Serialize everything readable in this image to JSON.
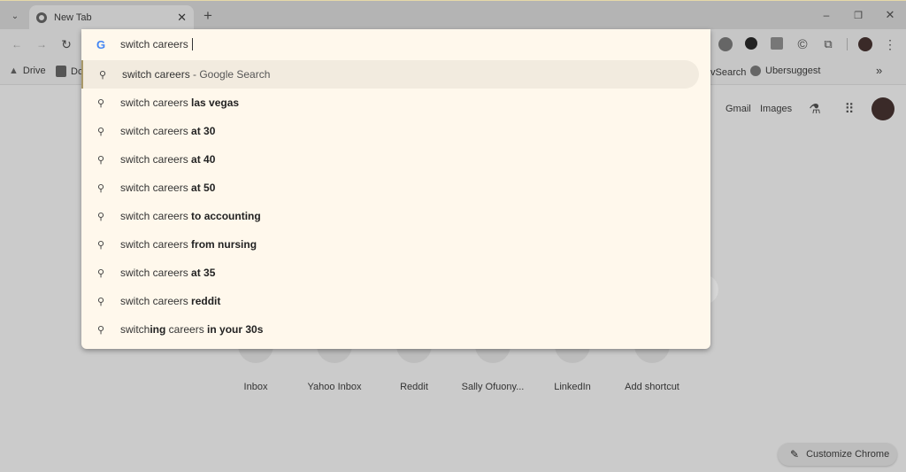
{
  "tabs": [
    {
      "title": "New Tab",
      "icon": "chrome-icon"
    }
  ],
  "window_controls": [
    "minimize",
    "restore",
    "close"
  ],
  "bookmarks": [
    {
      "label": "Drive"
    },
    {
      "label": "Dc"
    },
    {
      "label": "vSearch"
    },
    {
      "label": "Ubersuggest"
    }
  ],
  "omnibox": {
    "value": "switch careers"
  },
  "suggestions": [
    {
      "plain": "switch careers",
      "bold": "",
      "suffix": " - Google Search"
    },
    {
      "plain": "switch careers ",
      "bold": "las vegas"
    },
    {
      "plain": "switch careers ",
      "bold": "at 30"
    },
    {
      "plain": "switch careers ",
      "bold": "at 40"
    },
    {
      "plain": "switch careers ",
      "bold": "at 50"
    },
    {
      "plain": "switch careers ",
      "bold": "to accounting"
    },
    {
      "plain": "switch careers ",
      "bold": "from nursing"
    },
    {
      "plain": "switch careers ",
      "bold": "at 35"
    },
    {
      "plain": "switch careers ",
      "bold": "reddit"
    },
    {
      "plain": "switch",
      "bold": "ing",
      "plain2": " careers ",
      "bold2": "in your 30s"
    }
  ],
  "header_links": {
    "gmail": "Gmail",
    "images": "Images"
  },
  "shortcuts": [
    {
      "label": "Inbox"
    },
    {
      "label": "Yahoo Inbox"
    },
    {
      "label": "Reddit"
    },
    {
      "label": "Sally Ofuony..."
    },
    {
      "label": "LinkedIn"
    },
    {
      "label": "Add shortcut"
    }
  ],
  "customize": "Customize Chrome",
  "colors": {
    "dropdown_bg": "#fff8ec",
    "highlight": "#f2ebdf",
    "page_bg": "#cbcbcb"
  }
}
